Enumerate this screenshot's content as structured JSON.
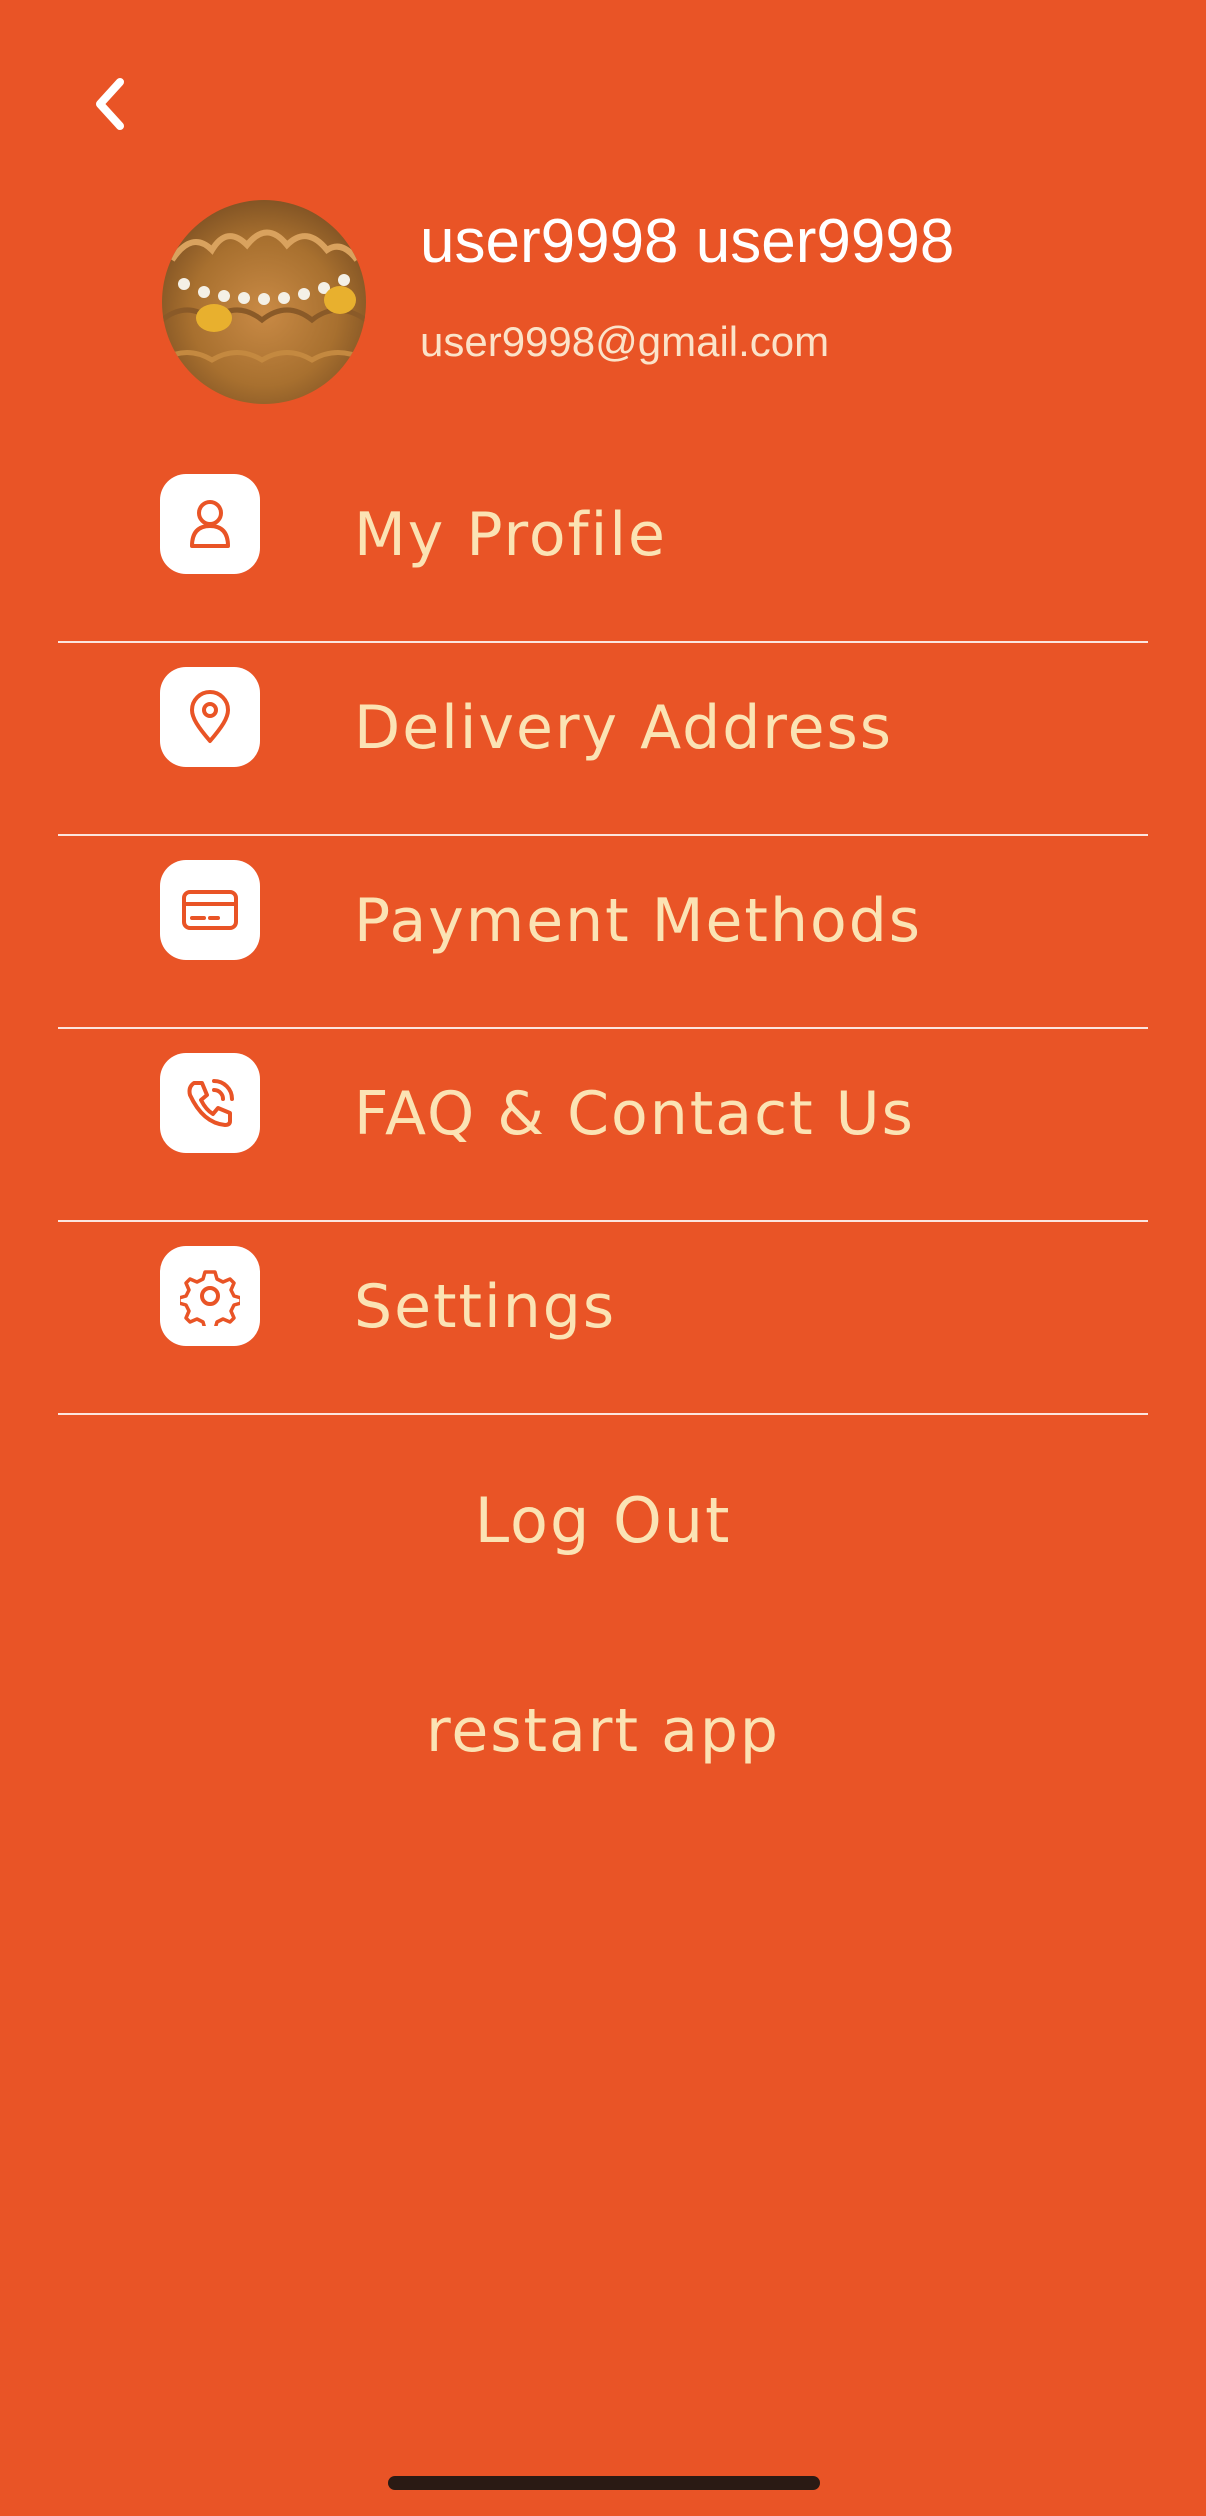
{
  "colors": {
    "background": "#E95426",
    "label": "#FBE3B4",
    "icon_box": "#FFFFFF",
    "icon_stroke": "#E95426"
  },
  "header": {
    "back_icon": "chevron-left-icon",
    "avatar_icon": "profile-photo",
    "user_name": "user9998 user9998",
    "user_email": "user9998@gmail.com"
  },
  "menu": {
    "items": [
      {
        "label": "My Profile",
        "icon": "person-icon"
      },
      {
        "label": "Delivery Address",
        "icon": "location-pin-icon"
      },
      {
        "label": "Payment Methods",
        "icon": "credit-card-icon"
      },
      {
        "label": "FAQ & Contact Us",
        "icon": "phone-call-icon"
      },
      {
        "label": "Settings",
        "icon": "gear-icon"
      }
    ]
  },
  "actions": {
    "logout_label": "Log Out",
    "restart_label": "restart app"
  }
}
